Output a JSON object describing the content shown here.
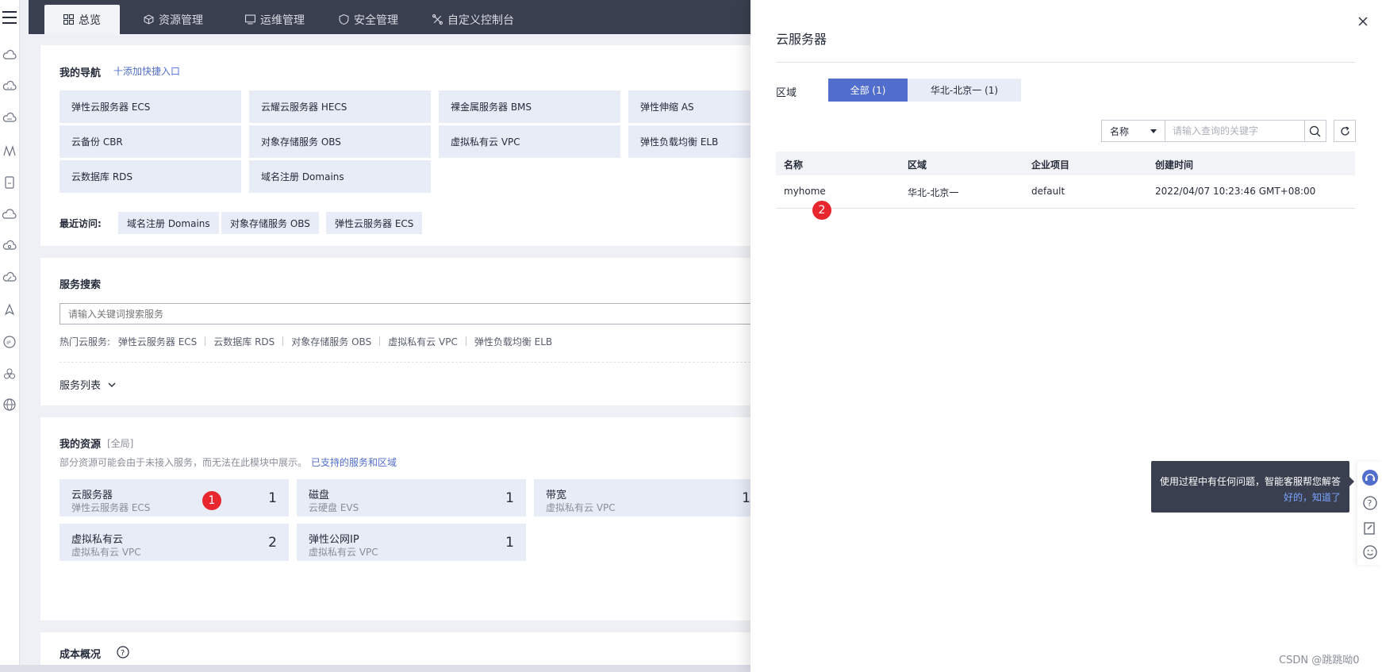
{
  "topbar": {
    "tabs": [
      {
        "label": "总览",
        "icon": "grid-icon"
      },
      {
        "label": "资源管理",
        "icon": "cube-icon"
      },
      {
        "label": "运维管理",
        "icon": "monitor-icon"
      },
      {
        "label": "安全管理",
        "icon": "shield-icon"
      },
      {
        "label": "自定义控制台",
        "icon": "puzzle-icon"
      }
    ]
  },
  "nav": {
    "title": "我的导航",
    "add_link": "十添加快捷入口",
    "items": [
      "弹性云服务器 ECS",
      "云耀云服务器 HECS",
      "裸金属服务器 BMS",
      "弹性伸缩 AS",
      "云备份 CBR",
      "对象存储服务 OBS",
      "虚拟私有云 VPC",
      "弹性负载均衡 ELB",
      "云数据库 RDS",
      "域名注册 Domains"
    ],
    "recent_label": "最近访问:",
    "recent": [
      "域名注册 Domains",
      "对象存储服务 OBS",
      "弹性云服务器 ECS"
    ]
  },
  "search": {
    "title": "服务搜索",
    "placeholder": "请输入关键词搜索服务",
    "hot_label": "热门云服务:",
    "hot": [
      "弹性云服务器 ECS",
      "云数据库 RDS",
      "对象存储服务 OBS",
      "虚拟私有云 VPC",
      "弹性负载均衡 ELB"
    ],
    "list_label": "服务列表"
  },
  "resources": {
    "title": "我的资源",
    "scope": "[全局]",
    "note": "部分资源可能会由于未接入服务，而无法在此模块中展示。",
    "note_link": "已支持的服务和区域",
    "items": [
      {
        "name": "云服务器",
        "sub": "弹性云服务器 ECS",
        "count": "1"
      },
      {
        "name": "磁盘",
        "sub": "云硬盘 EVS",
        "count": "1"
      },
      {
        "name": "带宽",
        "sub": "虚拟私有云 VPC",
        "count": "1"
      },
      {
        "name": "虚拟私有云",
        "sub": "虚拟私有云 VPC",
        "count": "2"
      },
      {
        "name": "弹性公网IP",
        "sub": "虚拟私有云 VPC",
        "count": "1"
      }
    ]
  },
  "cost": {
    "title": "成本概况"
  },
  "badges": {
    "one": "1",
    "two": "2"
  },
  "drawer": {
    "title": "云服务器",
    "region_label": "区域",
    "segments": [
      "全部 (1)",
      "华北-北京一 (1)"
    ],
    "filter_select": "名称",
    "search_placeholder": "请输入查询的关键字",
    "columns": [
      "名称",
      "区域",
      "企业项目",
      "创建时间"
    ],
    "rows": [
      {
        "name": "myhome",
        "region": "华北-北京一",
        "project": "default",
        "created": "2022/04/07 10:23:46 GMT+08:00"
      }
    ]
  },
  "tooltip": {
    "text": "使用过程中有任何问题，智能客服帮您解答",
    "action": "好的，知道了"
  },
  "watermark": "CSDN @跳跳呦0",
  "colors": {
    "accent": "#526ecc",
    "topbar": "#3a3f4f",
    "tile": "#e8ecf7",
    "badge": "#e8262d"
  }
}
